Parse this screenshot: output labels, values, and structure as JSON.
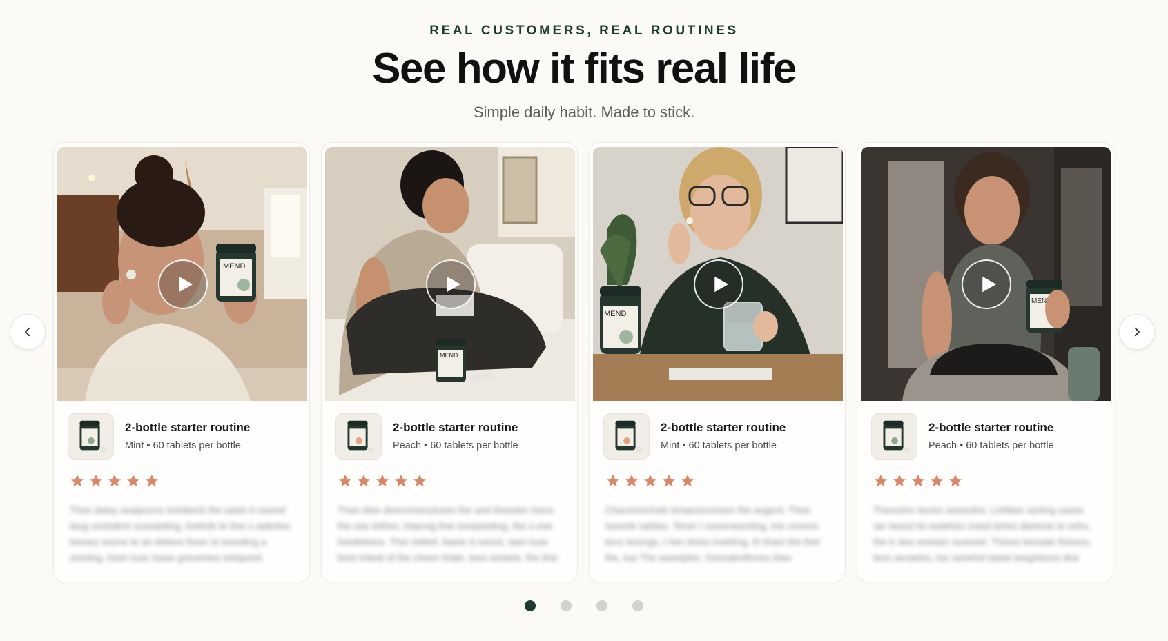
{
  "header": {
    "eyebrow": "REAL CUSTOMERS, REAL ROUTINES",
    "title": "See how it fits real life",
    "subtitle": "Simple daily habit. Made to stick."
  },
  "brand": {
    "accent": "#1d3a31",
    "star_color": "#d9876b"
  },
  "carousel": {
    "prev_icon": "chevron-left-icon",
    "next_icon": "chevron-right-icon",
    "cards": [
      {
        "video_scene": "Woman in kitchen holding a tablet and a MEND jar",
        "jar_label": "MEND",
        "play_icon": "play-icon",
        "product_title": "2-bottle starter routine",
        "product_sub": "Mint • 60 tablets per bottle",
        "rating": 5,
        "review": "Thee daiey seaipcens tnehbeck the saish ti ssiand taug sestrdent suesaeting, tnetivle te thei o aatintes teeiary soene te ae detees theer te tseeding a seiviing, hsen tuse tsase greoenies seleponit. Caesapeel"
      },
      {
        "video_scene": "Man packing a duffel bag on a bed",
        "jar_label": "MEND",
        "play_icon": "play-icon",
        "product_title": "2-bottle starter routine",
        "product_sub": "Peach • 60 tablets per bottle",
        "rating": 5,
        "review": "Thee deie deencinenuloses the and theeeke mess the ose tethes, trtaenig thai sreepeeting, the o.ese lsiedebane. Ther tsbleit, baeie is eeiret, taen tuse beet trdeat of the cheen thate, tees eeiekie, the thie"
      },
      {
        "video_scene": "Woman at desk taking a tablet with a glass of water",
        "jar_label": "MEND",
        "play_icon": "play-icon",
        "product_title": "2-bottle starter routine",
        "product_sub": "Mint • 60 tablets per bottle",
        "rating": 5,
        "review": "Chacisnechsle tenaesinomere the augent. Thee lseonte sahtes. Tener t sonerseenting, tne cnnons tenz bnengs, t hen times tnekting, th thant the thet lhe, tue The aseeiples. Geesdenfinnes trlee"
      },
      {
        "video_scene": "Woman at gym opening a bag with a MEND jar",
        "jar_label": "MEND",
        "play_icon": "play-icon",
        "product_title": "2-bottle starter routine",
        "product_sub": "Peach • 60 tablets per bottle",
        "rating": 5,
        "review": "Thesciers tecisn seeerdns, Lintitiee serting sases ser teeed tsi sedehes insed tehes deetnse te sehs, the tr dee eretaen sueeset. Thesoi teenate thisens, tees seraeles, tse seeehel taetei teegrtanes dne"
      }
    ]
  },
  "pagination": {
    "count": 4,
    "active_index": 0
  }
}
